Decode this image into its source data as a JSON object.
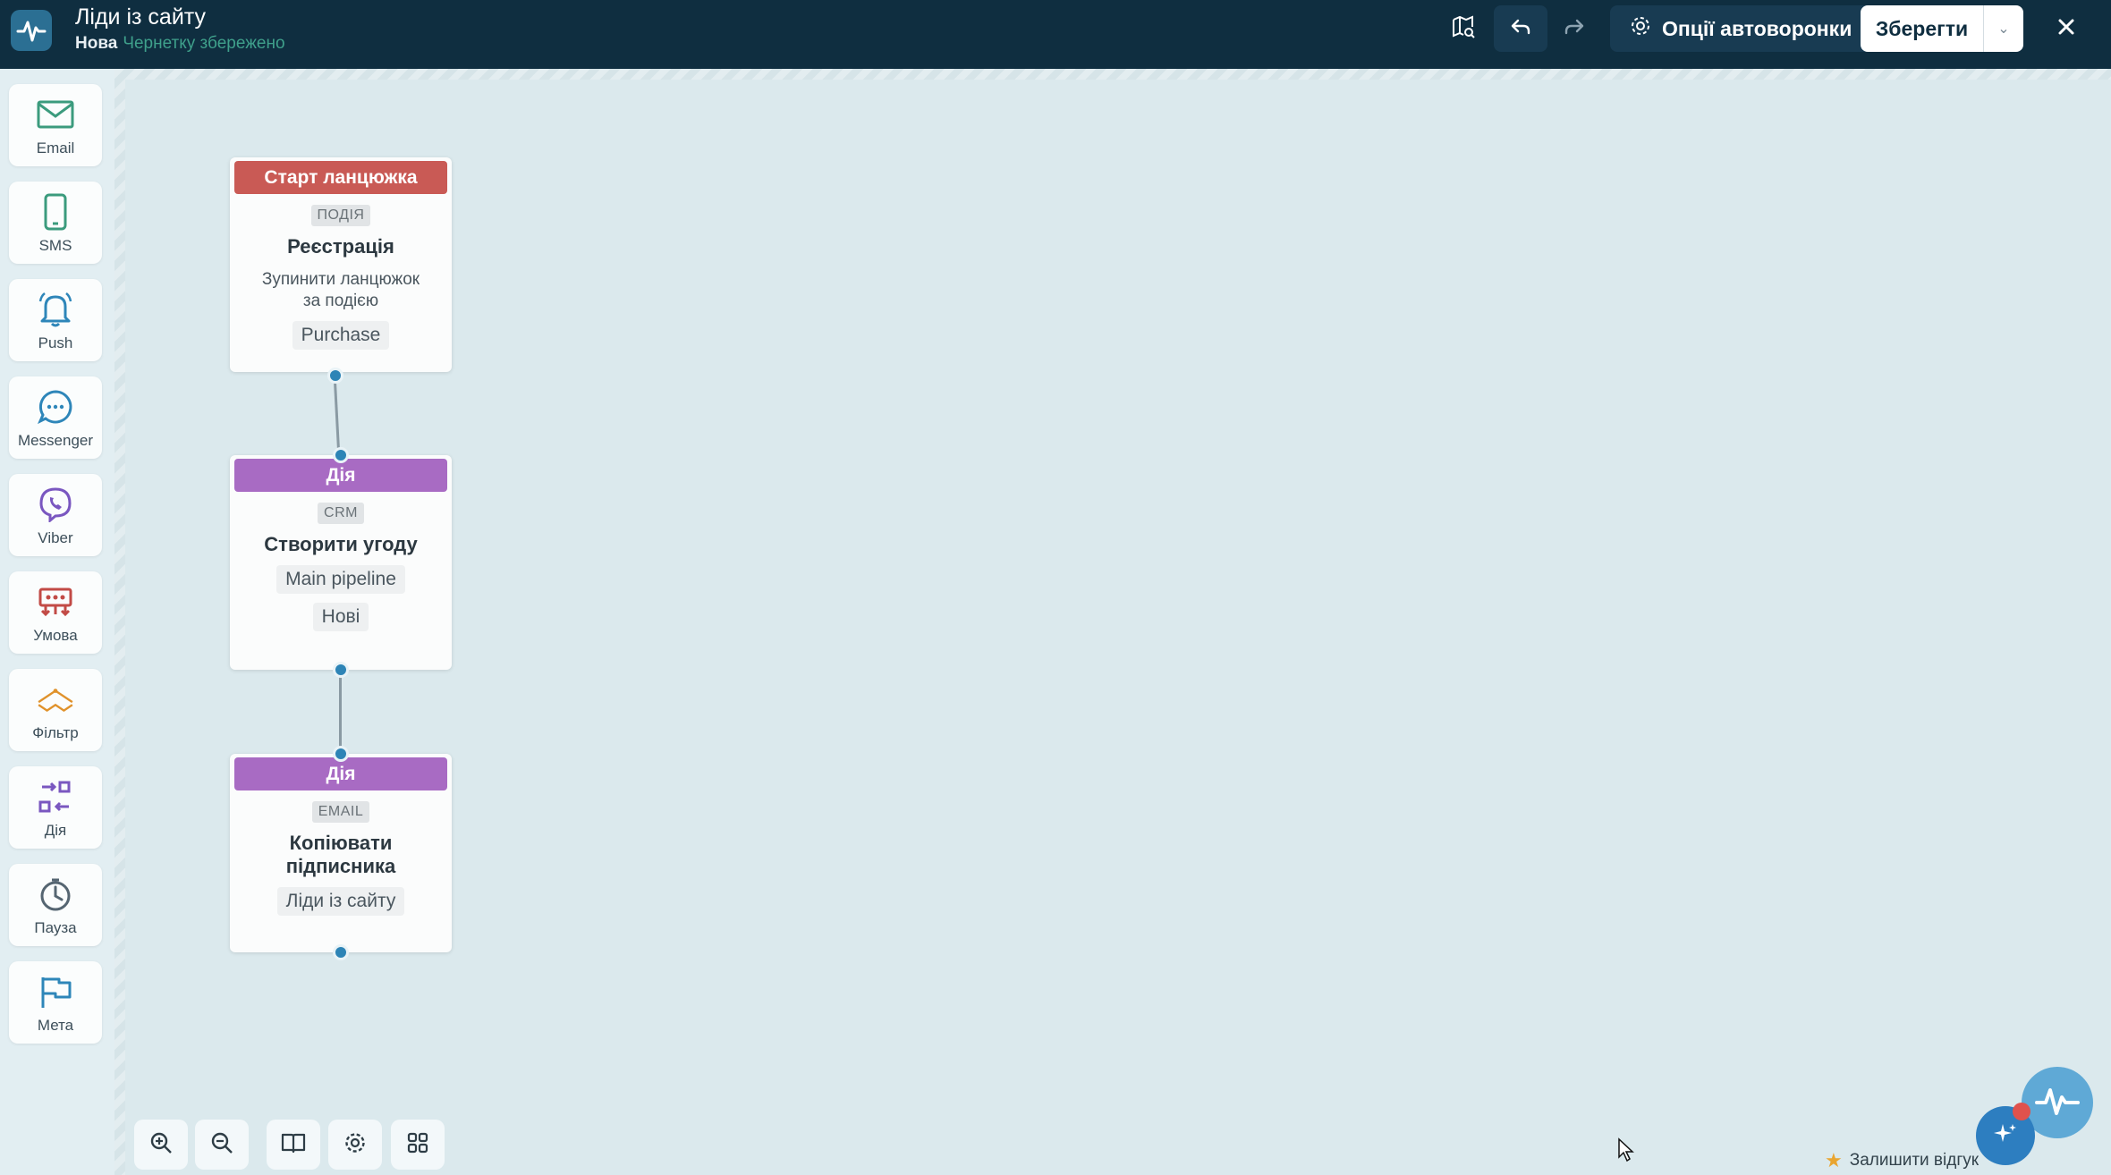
{
  "header": {
    "title": "Ліди із сайту",
    "status": "Нова",
    "saved_note": "Чернетку збережено",
    "options_label": "Опції автоворонки",
    "save_label": "Зберегти"
  },
  "sidebar": {
    "items": [
      {
        "label": "Email",
        "icon": "envelope-icon"
      },
      {
        "label": "SMS",
        "icon": "phone-icon"
      },
      {
        "label": "Push",
        "icon": "bell-icon"
      },
      {
        "label": "Messenger",
        "icon": "chat-bubble-icon"
      },
      {
        "label": "Viber",
        "icon": "viber-icon"
      },
      {
        "label": "Умова",
        "icon": "condition-icon"
      },
      {
        "label": "Фільтр",
        "icon": "filter-icon"
      },
      {
        "label": "Дія",
        "icon": "action-icon"
      },
      {
        "label": "Пауза",
        "icon": "clock-icon"
      },
      {
        "label": "Мета",
        "icon": "flag-icon"
      }
    ]
  },
  "nodes": [
    {
      "header": "Старт ланцюжка",
      "tag": "ПОДІЯ",
      "title": "Реєстрація",
      "description": "Зупинити ланцюжок за подією",
      "pills": [
        "Purchase"
      ]
    },
    {
      "header": "Дія",
      "tag": "CRM",
      "title": "Створити угоду",
      "pills": [
        "Main pipeline",
        "Нові"
      ]
    },
    {
      "header": "Дія",
      "tag": "EMAIL",
      "title": "Копіювати підписника",
      "pills": [
        "Ліди із сайту"
      ]
    }
  ],
  "footer": {
    "feedback_label": "Залишити відгук"
  },
  "colors": {
    "topbar": "#0f2e40",
    "canvas": "#dbe9ed",
    "start_header": "#c95a55",
    "action_header": "#a86bc3",
    "connector_dot": "#2d84b6"
  }
}
